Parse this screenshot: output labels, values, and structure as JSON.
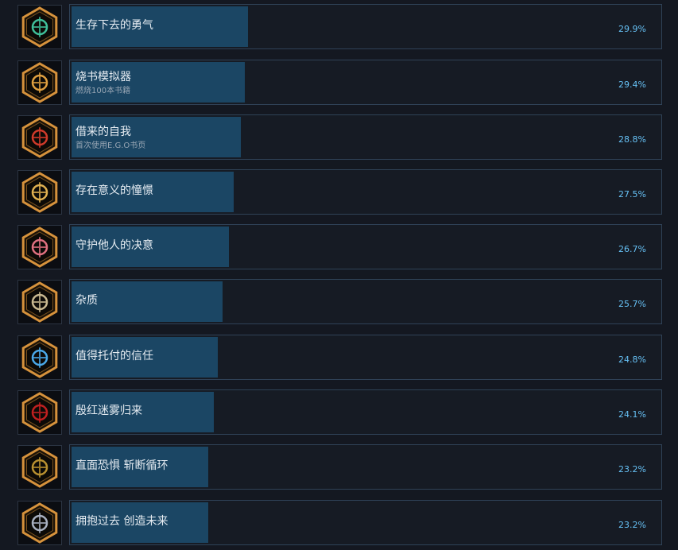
{
  "achievements": [
    {
      "name": "生存下去的勇气",
      "description": "",
      "percent": "29.9%",
      "rate": 29.9,
      "icon": "teal-crest-icon",
      "glyph_color": "#3fbf9a"
    },
    {
      "name": "烧书模拟器",
      "description": "燃烧100本书籍",
      "percent": "29.4%",
      "rate": 29.4,
      "icon": "flaming-book-icon",
      "glyph_color": "#e0a040"
    },
    {
      "name": "借来的自我",
      "description": "首次使用E.G.O书页",
      "percent": "28.8%",
      "rate": 28.8,
      "icon": "red-mask-icon",
      "glyph_color": "#d03a2a"
    },
    {
      "name": "存在意义的憧憬",
      "description": "",
      "percent": "27.5%",
      "rate": 27.5,
      "icon": "golden-cross-icon",
      "glyph_color": "#e0b050"
    },
    {
      "name": "守护他人的决意",
      "description": "",
      "percent": "26.7%",
      "rate": 26.7,
      "icon": "pink-sword-icon",
      "glyph_color": "#e07080"
    },
    {
      "name": "杂质",
      "description": "",
      "percent": "25.7%",
      "rate": 25.7,
      "icon": "rune-circle-icon",
      "glyph_color": "#c8b890"
    },
    {
      "name": "值得托付的信任",
      "description": "",
      "percent": "24.8%",
      "rate": 24.8,
      "icon": "blue-shield-icon",
      "glyph_color": "#4aa8e8"
    },
    {
      "name": "殷红迷雾归来",
      "description": "",
      "percent": "24.1%",
      "rate": 24.1,
      "icon": "red-mist-icon",
      "glyph_color": "#c02020"
    },
    {
      "name": "直面恐惧 斩断循环",
      "description": "",
      "percent": "23.2%",
      "rate": 23.2,
      "icon": "golden-lion-icon",
      "glyph_color": "#b89030"
    },
    {
      "name": "拥抱过去 创造未来",
      "description": "",
      "percent": "23.2%",
      "rate": 23.2,
      "icon": "silver-wolf-icon",
      "glyph_color": "#a8b0c0"
    }
  ],
  "colors": {
    "background": "#141821",
    "bar_fill": "#1b4664",
    "bar_border": "#2f4257",
    "percent_text": "#66c0f4",
    "badge_rim": "#d6923c"
  }
}
